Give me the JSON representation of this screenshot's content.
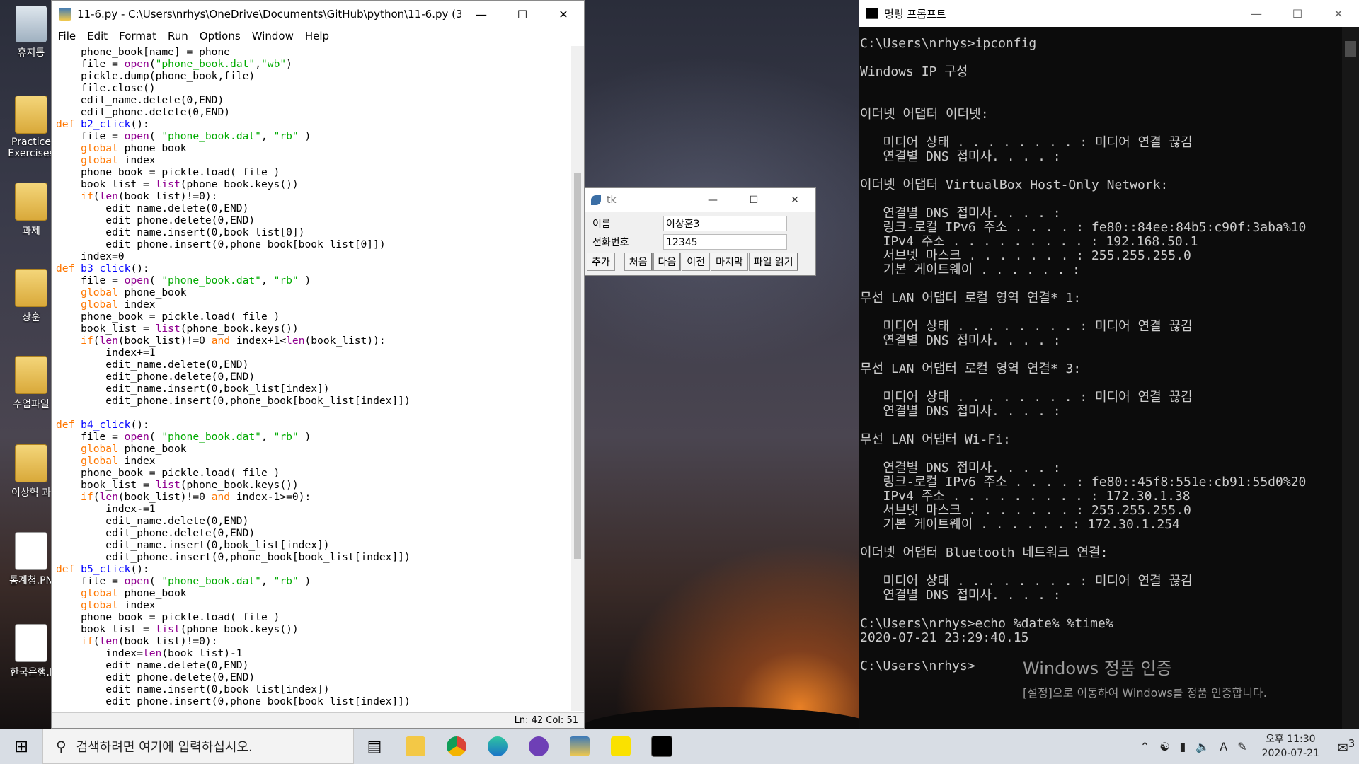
{
  "desktop": {
    "icons": [
      "휴지통",
      "Practice Exercises",
      "과제",
      "상훈",
      "수업파일",
      "이상혁 과",
      "통계청.PN",
      "한국은행.I"
    ]
  },
  "editor": {
    "title": "11-6.py - C:\\Users\\nrhys\\OneDrive\\Documents\\GitHub\\python\\11-6.py (3...",
    "menu": [
      "File",
      "Edit",
      "Format",
      "Run",
      "Options",
      "Window",
      "Help"
    ],
    "status": "Ln: 42   Col: 51",
    "code_lines": [
      "    phone_book[name] = phone",
      "    file = open(\"phone_book.dat\",\"wb\")",
      "    pickle.dump(phone_book,file)",
      "    file.close()",
      "    edit_name.delete(0,END)",
      "    edit_phone.delete(0,END)",
      "def b2_click():",
      "    file = open( \"phone_book.dat\", \"rb\" )",
      "    global phone_book",
      "    global index",
      "    phone_book = pickle.load( file )",
      "    book_list = list(phone_book.keys())",
      "    if(len(book_list)!=0):",
      "        edit_name.delete(0,END)",
      "        edit_phone.delete(0,END)",
      "        edit_name.insert(0,book_list[0])",
      "        edit_phone.insert(0,phone_book[book_list[0]])",
      "    index=0",
      "def b3_click():",
      "    file = open( \"phone_book.dat\", \"rb\" )",
      "    global phone_book",
      "    global index",
      "    phone_book = pickle.load( file )",
      "    book_list = list(phone_book.keys())",
      "    if(len(book_list)!=0 and index+1<len(book_list)):",
      "        index+=1",
      "        edit_name.delete(0,END)",
      "        edit_phone.delete(0,END)",
      "        edit_name.insert(0,book_list[index])",
      "        edit_phone.insert(0,phone_book[book_list[index]])",
      "",
      "def b4_click():",
      "    file = open( \"phone_book.dat\", \"rb\" )",
      "    global phone_book",
      "    global index",
      "    phone_book = pickle.load( file )",
      "    book_list = list(phone_book.keys())",
      "    if(len(book_list)!=0 and index-1>=0):",
      "        index-=1",
      "        edit_name.delete(0,END)",
      "        edit_phone.delete(0,END)",
      "        edit_name.insert(0,book_list[index])",
      "        edit_phone.insert(0,phone_book[book_list[index]])",
      "def b5_click():",
      "    file = open( \"phone_book.dat\", \"rb\" )",
      "    global phone_book",
      "    global index",
      "    phone_book = pickle.load( file )",
      "    book_list = list(phone_book.keys())",
      "    if(len(book_list)!=0):",
      "        index=len(book_list)-1",
      "        edit_name.delete(0,END)",
      "        edit_phone.delete(0,END)",
      "        edit_name.insert(0,book_list[index])",
      "        edit_phone.insert(0,phone_book[book_list[index]])"
    ]
  },
  "tk": {
    "title": "tk",
    "name_label": "이름",
    "name_value": "이상훈3",
    "phone_label": "전화번호",
    "phone_value": "12345",
    "buttons": [
      "추가",
      "처음",
      "다음",
      "이전",
      "마지막",
      "파일 읽기"
    ]
  },
  "console": {
    "title": "명령 프롬프트",
    "text": "C:\\Users\\nrhys>ipconfig\n\nWindows IP 구성\n\n\n이더넷 어댑터 이더넷:\n\n   미디어 상태 . . . . . . . . : 미디어 연결 끊김\n   연결별 DNS 접미사. . . . :\n\n이더넷 어댑터 VirtualBox Host-Only Network:\n\n   연결별 DNS 접미사. . . . :\n   링크-로컬 IPv6 주소 . . . . : fe80::84ee:84b5:c90f:3aba%10\n   IPv4 주소 . . . . . . . . . : 192.168.50.1\n   서브넷 마스크 . . . . . . . : 255.255.255.0\n   기본 게이트웨이 . . . . . . :\n\n무선 LAN 어댑터 로컬 영역 연결* 1:\n\n   미디어 상태 . . . . . . . . : 미디어 연결 끊김\n   연결별 DNS 접미사. . . . :\n\n무선 LAN 어댑터 로컬 영역 연결* 3:\n\n   미디어 상태 . . . . . . . . : 미디어 연결 끊김\n   연결별 DNS 접미사. . . . :\n\n무선 LAN 어댑터 Wi-Fi:\n\n   연결별 DNS 접미사. . . . :\n   링크-로컬 IPv6 주소 . . . . : fe80::45f8:551e:cb91:55d0%20\n   IPv4 주소 . . . . . . . . . : 172.30.1.38\n   서브넷 마스크 . . . . . . . : 255.255.255.0\n   기본 게이트웨이 . . . . . . : 172.30.1.254\n\n이더넷 어댑터 Bluetooth 네트워크 연결:\n\n   미디어 상태 . . . . . . . . : 미디어 연결 끊김\n   연결별 DNS 접미사. . . . :\n\nC:\\Users\\nrhys>echo %date% %time%\n2020-07-21 23:29:40.15\n\nC:\\Users\\nrhys>",
    "watermark_title": "Windows 정품 인증",
    "watermark_sub": "[설정]으로 이동하여 Windows를 정품 인증합니다."
  },
  "taskbar": {
    "search_placeholder": "검색하려면 여기에 입력하십시오.",
    "time": "오후 11:30",
    "date": "2020-07-21",
    "notification_count": "3"
  }
}
